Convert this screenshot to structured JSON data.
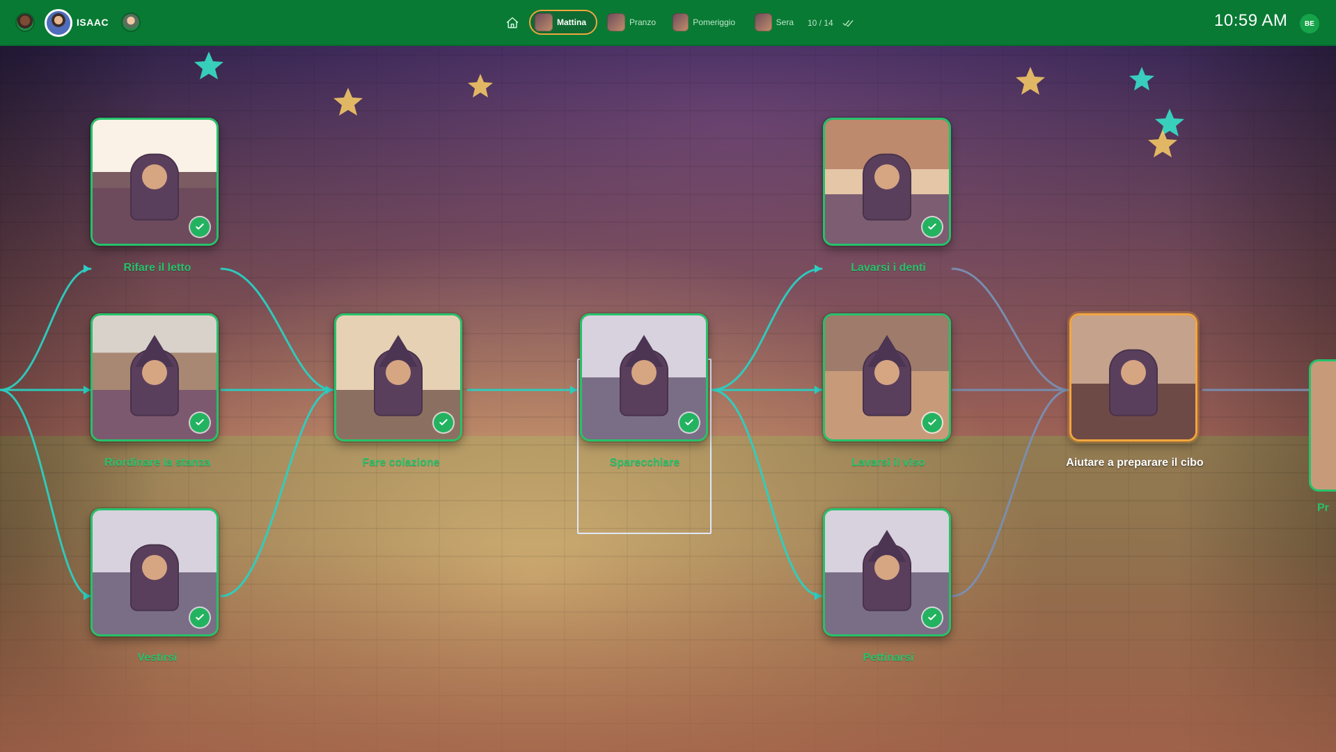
{
  "topbar": {
    "user_name": "ISAAC",
    "segments": [
      {
        "label": "Mattina",
        "active": true
      },
      {
        "label": "Pranzo",
        "active": false
      },
      {
        "label": "Pomeriggio",
        "active": false
      },
      {
        "label": "Sera",
        "active": false
      }
    ],
    "progress": "10 / 14",
    "clock": "10:59 AM",
    "user_badge": "BE"
  },
  "icons": {
    "home": "home-icon",
    "double_check": "double-check-icon",
    "check": "check-icon"
  },
  "colors": {
    "topbar": "#087a34",
    "done": "#25c26a",
    "active": "#f3a63f"
  },
  "tasks": [
    {
      "label": "Rifare il letto",
      "done": true
    },
    {
      "label": "Riordinare la stanza",
      "done": true
    },
    {
      "label": "Vestirsi",
      "done": true
    },
    {
      "label": "Fare colazione",
      "done": true
    },
    {
      "label": "Sparecchiare",
      "done": true
    },
    {
      "label": "Lavarsi i denti",
      "done": true
    },
    {
      "label": "Lavarsi il viso",
      "done": true
    },
    {
      "label": "Pettinarsi",
      "done": true
    },
    {
      "label": "Aiutare a preparare il cibo",
      "done": false
    },
    {
      "label": "Pr",
      "done": false
    }
  ]
}
